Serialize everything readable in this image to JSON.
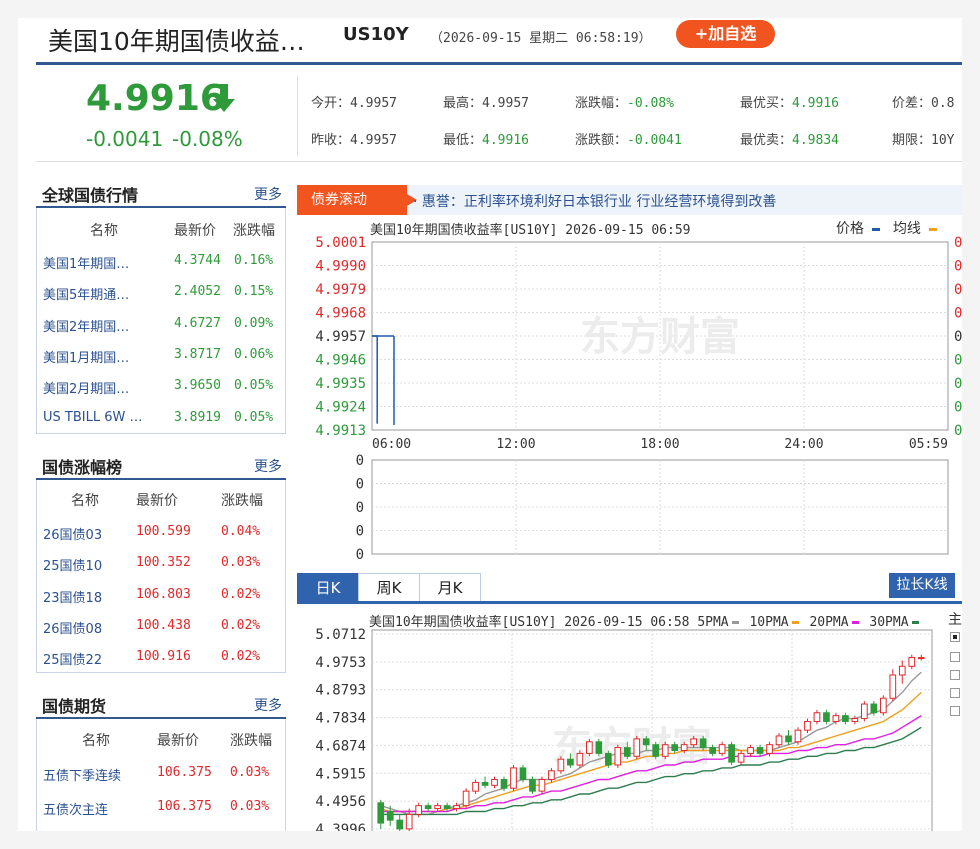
{
  "header": {
    "name": "美国10年期国债收益…",
    "code": "US10Y",
    "datetime": "（2026-09-15 星期二 06:58:19）",
    "add_button": "+加自选"
  },
  "quote": {
    "price": "4.9916",
    "change": "-0.0041",
    "change_pct": "-0.08%",
    "fields": [
      {
        "label": "今开：",
        "value": "4.9957"
      },
      {
        "label": "昨收：",
        "value": "4.9957"
      },
      {
        "label": "最高：",
        "value": "4.9957"
      },
      {
        "label": "最低：",
        "value": "4.9916"
      },
      {
        "label": "涨跌幅：",
        "value": "-0.08%"
      },
      {
        "label": "涨跌额：",
        "value": "-0.0041"
      },
      {
        "label": "最优买：",
        "value": "4.9916"
      },
      {
        "label": "最优卖：",
        "value": "4.9834"
      },
      {
        "label": "价差：",
        "value": "0.8"
      },
      {
        "label": "期限：",
        "value": "10Y"
      }
    ]
  },
  "global_bonds": {
    "title": "全球国债行情",
    "more": "更多",
    "headers": [
      "名称",
      "最新价",
      "涨跌幅"
    ],
    "rows": [
      {
        "name": "美国1年期国…",
        "price": "4.3744",
        "pct": "0.16%"
      },
      {
        "name": "美国5年期通…",
        "price": "2.4052",
        "pct": "0.15%"
      },
      {
        "name": "美国2年期国…",
        "price": "4.6727",
        "pct": "0.09%"
      },
      {
        "name": "美国1月期国…",
        "price": "3.8717",
        "pct": "0.06%"
      },
      {
        "name": "美国2月期国…",
        "price": "3.9650",
        "pct": "0.05%"
      },
      {
        "name": "US TBILL 6W …",
        "price": "3.8919",
        "pct": "0.05%"
      }
    ]
  },
  "bond_gainers": {
    "title": "国债涨幅榜",
    "more": "更多",
    "headers": [
      "名称",
      "最新价",
      "涨跌幅"
    ],
    "rows": [
      {
        "name": "26国债03",
        "price": "100.599",
        "pct": "0.04%"
      },
      {
        "name": "25国债10",
        "price": "100.352",
        "pct": "0.03%"
      },
      {
        "name": "23国债18",
        "price": "106.803",
        "pct": "0.02%"
      },
      {
        "name": "26国债08",
        "price": "100.438",
        "pct": "0.02%"
      },
      {
        "name": "25国债22",
        "price": "100.916",
        "pct": "0.02%"
      }
    ]
  },
  "bond_futures": {
    "title": "国债期货",
    "more": "更多",
    "headers": [
      "名称",
      "最新价",
      "涨跌幅"
    ],
    "rows": [
      {
        "name": "五债下季连续",
        "price": "106.375",
        "pct": "0.03%"
      },
      {
        "name": "五债次主连",
        "price": "106.375",
        "pct": "0.03%"
      }
    ]
  },
  "marquee": {
    "tag": "债券滚动",
    "text": "· 惠誉：正利率环境利好日本银行业  行业经营环境得到改善"
  },
  "intraday": {
    "title": "美国10年期国债收益率[US10Y] 2026-09-15 06:59",
    "legend_price": "价格",
    "legend_avg": "均线",
    "watermark": "东方财富",
    "y_labels": [
      "5.0001",
      "4.9990",
      "4.9979",
      "4.9968",
      "4.9957",
      "4.9946",
      "4.9935",
      "4.9924",
      "4.9913"
    ],
    "right_labels": [
      "0",
      "0",
      "0",
      "0",
      "0",
      "0",
      "0",
      "0",
      "0"
    ],
    "x_labels": [
      "06:00",
      "12:00",
      "18:00",
      "24:00",
      "05:59"
    ],
    "vol_labels": [
      "0",
      "0",
      "0",
      "0",
      "0"
    ],
    "colors": {
      "up": "#e0292b",
      "down": "#2e9a3a",
      "neutral": "#333333",
      "price_line": "#1f5ba8",
      "avg_line": "#f0a020"
    }
  },
  "kline": {
    "tabs": [
      "日K",
      "周K",
      "月K"
    ],
    "stretch_button": "拉长K线",
    "right_label": "主",
    "title": "美国10年期国债收益率[US10Y] 2026-09-15 06:58",
    "ma": [
      {
        "label": "5PMA",
        "color": "#999999"
      },
      {
        "label": "10PMA",
        "color": "#f0a020"
      },
      {
        "label": "20PMA",
        "color": "#e020e0"
      },
      {
        "label": "30PMA",
        "color": "#2e7d4f"
      }
    ],
    "y_labels": [
      "5.0712",
      "4.9753",
      "4.8793",
      "4.7834",
      "4.6874",
      "4.5915",
      "4.4956",
      "4.3996"
    ],
    "watermark": "东方财富"
  },
  "chart_data": [
    {
      "type": "line",
      "title": "美国10年期国债收益率[US10Y] 2026-09-15 06:59",
      "x": [
        "06:00",
        "06:01",
        "06:02",
        "06:03",
        "06:04",
        "06:05",
        "06:06",
        "06:07",
        "06:08",
        "06:09",
        "06:10",
        "06:11",
        "06:12",
        "06:13"
      ],
      "series": [
        {
          "name": "价格",
          "values": [
            4.9957,
            4.9957,
            4.9957,
            4.9957,
            4.9957,
            4.9957,
            4.9957,
            4.9957,
            4.9957,
            4.9957,
            4.9957,
            4.9957,
            4.9957,
            4.9916
          ]
        }
      ],
      "ylim": [
        4.9913,
        5.0001
      ],
      "x_ticks": [
        "06:00",
        "12:00",
        "18:00",
        "24:00",
        "05:59"
      ],
      "grid": true
    },
    {
      "type": "candlestick",
      "title": "美国10年期国债收益率[US10Y] 2026-09-15 06:58",
      "ylim": [
        4.3996,
        5.0712
      ],
      "candles": [
        {
          "o": 4.49,
          "c": 4.42,
          "h": 4.5,
          "l": 4.4
        },
        {
          "o": 4.46,
          "c": 4.43,
          "h": 4.48,
          "l": 4.41
        },
        {
          "o": 4.43,
          "c": 4.4,
          "h": 4.45,
          "l": 4.39
        },
        {
          "o": 4.4,
          "c": 4.45,
          "h": 4.47,
          "l": 4.39
        },
        {
          "o": 4.45,
          "c": 4.48,
          "h": 4.49,
          "l": 4.44
        },
        {
          "o": 4.48,
          "c": 4.47,
          "h": 4.49,
          "l": 4.46
        },
        {
          "o": 4.47,
          "c": 4.48,
          "h": 4.49,
          "l": 4.46
        },
        {
          "o": 4.48,
          "c": 4.47,
          "h": 4.49,
          "l": 4.46
        },
        {
          "o": 4.47,
          "c": 4.48,
          "h": 4.49,
          "l": 4.46
        },
        {
          "o": 4.48,
          "c": 4.53,
          "h": 4.54,
          "l": 4.47
        },
        {
          "o": 4.53,
          "c": 4.56,
          "h": 4.57,
          "l": 4.52
        },
        {
          "o": 4.56,
          "c": 4.55,
          "h": 4.58,
          "l": 4.54
        },
        {
          "o": 4.55,
          "c": 4.57,
          "h": 4.58,
          "l": 4.54
        },
        {
          "o": 4.57,
          "c": 4.54,
          "h": 4.58,
          "l": 4.53
        },
        {
          "o": 4.54,
          "c": 4.61,
          "h": 4.62,
          "l": 4.53
        },
        {
          "o": 4.61,
          "c": 4.57,
          "h": 4.62,
          "l": 4.56
        },
        {
          "o": 4.57,
          "c": 4.53,
          "h": 4.58,
          "l": 4.52
        },
        {
          "o": 4.53,
          "c": 4.57,
          "h": 4.58,
          "l": 4.52
        },
        {
          "o": 4.57,
          "c": 4.6,
          "h": 4.61,
          "l": 4.56
        },
        {
          "o": 4.6,
          "c": 4.64,
          "h": 4.65,
          "l": 4.59
        },
        {
          "o": 4.64,
          "c": 4.62,
          "h": 4.66,
          "l": 4.61
        },
        {
          "o": 4.62,
          "c": 4.66,
          "h": 4.67,
          "l": 4.61
        },
        {
          "o": 4.66,
          "c": 4.7,
          "h": 4.71,
          "l": 4.65
        },
        {
          "o": 4.7,
          "c": 4.66,
          "h": 4.71,
          "l": 4.65
        },
        {
          "o": 4.66,
          "c": 4.62,
          "h": 4.67,
          "l": 4.61
        },
        {
          "o": 4.62,
          "c": 4.68,
          "h": 4.69,
          "l": 4.61
        },
        {
          "o": 4.68,
          "c": 4.65,
          "h": 4.7,
          "l": 4.64
        },
        {
          "o": 4.65,
          "c": 4.71,
          "h": 4.72,
          "l": 4.64
        },
        {
          "o": 4.71,
          "c": 4.69,
          "h": 4.72,
          "l": 4.67
        },
        {
          "o": 4.69,
          "c": 4.65,
          "h": 4.7,
          "l": 4.64
        },
        {
          "o": 4.65,
          "c": 4.69,
          "h": 4.7,
          "l": 4.64
        },
        {
          "o": 4.69,
          "c": 4.67,
          "h": 4.7,
          "l": 4.66
        },
        {
          "o": 4.67,
          "c": 4.69,
          "h": 4.7,
          "l": 4.66
        },
        {
          "o": 4.69,
          "c": 4.71,
          "h": 4.72,
          "l": 4.68
        },
        {
          "o": 4.71,
          "c": 4.68,
          "h": 4.72,
          "l": 4.67
        },
        {
          "o": 4.68,
          "c": 4.66,
          "h": 4.69,
          "l": 4.65
        },
        {
          "o": 4.66,
          "c": 4.69,
          "h": 4.7,
          "l": 4.65
        },
        {
          "o": 4.69,
          "c": 4.63,
          "h": 4.7,
          "l": 4.62
        },
        {
          "o": 4.63,
          "c": 4.66,
          "h": 4.67,
          "l": 4.62
        },
        {
          "o": 4.66,
          "c": 4.68,
          "h": 4.69,
          "l": 4.65
        },
        {
          "o": 4.68,
          "c": 4.66,
          "h": 4.69,
          "l": 4.65
        },
        {
          "o": 4.66,
          "c": 4.69,
          "h": 4.7,
          "l": 4.65
        },
        {
          "o": 4.69,
          "c": 4.72,
          "h": 4.73,
          "l": 4.68
        },
        {
          "o": 4.72,
          "c": 4.7,
          "h": 4.74,
          "l": 4.69
        },
        {
          "o": 4.7,
          "c": 4.74,
          "h": 4.75,
          "l": 4.69
        },
        {
          "o": 4.74,
          "c": 4.77,
          "h": 4.78,
          "l": 4.73
        },
        {
          "o": 4.77,
          "c": 4.8,
          "h": 4.81,
          "l": 4.76
        },
        {
          "o": 4.8,
          "c": 4.77,
          "h": 4.81,
          "l": 4.76
        },
        {
          "o": 4.77,
          "c": 4.79,
          "h": 4.8,
          "l": 4.76
        },
        {
          "o": 4.79,
          "c": 4.77,
          "h": 4.8,
          "l": 4.76
        },
        {
          "o": 4.77,
          "c": 4.78,
          "h": 4.79,
          "l": 4.76
        },
        {
          "o": 4.78,
          "c": 4.83,
          "h": 4.84,
          "l": 4.77
        },
        {
          "o": 4.83,
          "c": 4.8,
          "h": 4.84,
          "l": 4.79
        },
        {
          "o": 4.8,
          "c": 4.85,
          "h": 4.86,
          "l": 4.79
        },
        {
          "o": 4.85,
          "c": 4.93,
          "h": 4.95,
          "l": 4.84
        },
        {
          "o": 4.93,
          "c": 4.96,
          "h": 4.98,
          "l": 4.9
        },
        {
          "o": 4.96,
          "c": 4.99,
          "h": 5.0,
          "l": 4.95
        },
        {
          "o": 4.99,
          "c": 4.99,
          "h": 5.0,
          "l": 4.98
        }
      ],
      "ma": {
        "5PMA": [
          4.48,
          4.47,
          4.46,
          4.45,
          4.45,
          4.45,
          4.46,
          4.47,
          4.48,
          4.49,
          4.5,
          4.52,
          4.53,
          4.54,
          4.56,
          4.57,
          4.57,
          4.57,
          4.57,
          4.58,
          4.59,
          4.61,
          4.63,
          4.64,
          4.65,
          4.66,
          4.66,
          4.66,
          4.67,
          4.67,
          4.68,
          4.68,
          4.68,
          4.68,
          4.68,
          4.68,
          4.68,
          4.68,
          4.67,
          4.67,
          4.67,
          4.67,
          4.68,
          4.69,
          4.7,
          4.72,
          4.74,
          4.75,
          4.77,
          4.78,
          4.78,
          4.79,
          4.8,
          4.81,
          4.84,
          4.87,
          4.91,
          4.94
        ],
        "10PMA": [
          4.47,
          4.46,
          4.46,
          4.46,
          4.46,
          4.46,
          4.46,
          4.47,
          4.47,
          4.48,
          4.49,
          4.5,
          4.51,
          4.52,
          4.53,
          4.54,
          4.55,
          4.55,
          4.56,
          4.57,
          4.58,
          4.59,
          4.6,
          4.61,
          4.62,
          4.63,
          4.63,
          4.64,
          4.65,
          4.65,
          4.66,
          4.66,
          4.67,
          4.67,
          4.67,
          4.67,
          4.67,
          4.67,
          4.67,
          4.67,
          4.67,
          4.67,
          4.67,
          4.68,
          4.68,
          4.69,
          4.7,
          4.71,
          4.72,
          4.73,
          4.74,
          4.75,
          4.76,
          4.77,
          4.79,
          4.81,
          4.84,
          4.87
        ],
        "20PMA": [
          4.46,
          4.46,
          4.46,
          4.46,
          4.46,
          4.46,
          4.46,
          4.46,
          4.47,
          4.47,
          4.48,
          4.48,
          4.49,
          4.49,
          4.5,
          4.51,
          4.51,
          4.52,
          4.53,
          4.53,
          4.54,
          4.55,
          4.56,
          4.57,
          4.57,
          4.58,
          4.59,
          4.6,
          4.6,
          4.61,
          4.62,
          4.62,
          4.63,
          4.63,
          4.64,
          4.64,
          4.64,
          4.65,
          4.65,
          4.65,
          4.65,
          4.66,
          4.66,
          4.66,
          4.67,
          4.67,
          4.68,
          4.68,
          4.69,
          4.69,
          4.7,
          4.71,
          4.71,
          4.72,
          4.73,
          4.75,
          4.77,
          4.79
        ],
        "30PMA": [
          4.45,
          4.45,
          4.45,
          4.45,
          4.45,
          4.45,
          4.45,
          4.45,
          4.45,
          4.46,
          4.46,
          4.46,
          4.47,
          4.47,
          4.48,
          4.48,
          4.49,
          4.49,
          4.5,
          4.5,
          4.51,
          4.52,
          4.52,
          4.53,
          4.54,
          4.54,
          4.55,
          4.56,
          4.56,
          4.57,
          4.58,
          4.58,
          4.59,
          4.59,
          4.6,
          4.6,
          4.61,
          4.61,
          4.62,
          4.62,
          4.62,
          4.63,
          4.63,
          4.64,
          4.64,
          4.65,
          4.65,
          4.66,
          4.66,
          4.67,
          4.67,
          4.68,
          4.68,
          4.69,
          4.7,
          4.71,
          4.73,
          4.75
        ]
      }
    }
  ]
}
